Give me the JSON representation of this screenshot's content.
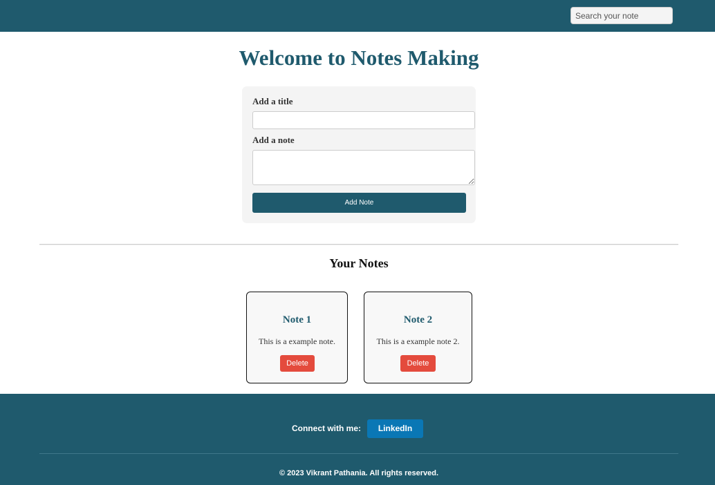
{
  "navbar": {
    "search_placeholder": "Search your note"
  },
  "main": {
    "title": "Welcome to Notes Making",
    "form": {
      "title_label": "Add a title",
      "title_value": "",
      "note_label": "Add a note",
      "note_value": "",
      "submit_label": "Add Note"
    },
    "notes_heading": "Your Notes",
    "notes": [
      {
        "title": "Note 1",
        "body": "This is a example note.",
        "delete_label": "Delete"
      },
      {
        "title": "Note 2",
        "body": "This is a example note 2.",
        "delete_label": "Delete"
      }
    ]
  },
  "footer": {
    "connect_label": "Connect with me:",
    "linkedin_label": "LinkedIn",
    "copyright": "© 2023 Vikrant Pathania. All rights reserved."
  },
  "colors": {
    "primary": "#1f5a6d",
    "danger": "#e44b3d",
    "linkedin": "#0a77b5",
    "card_bg": "#f4f4f4"
  }
}
